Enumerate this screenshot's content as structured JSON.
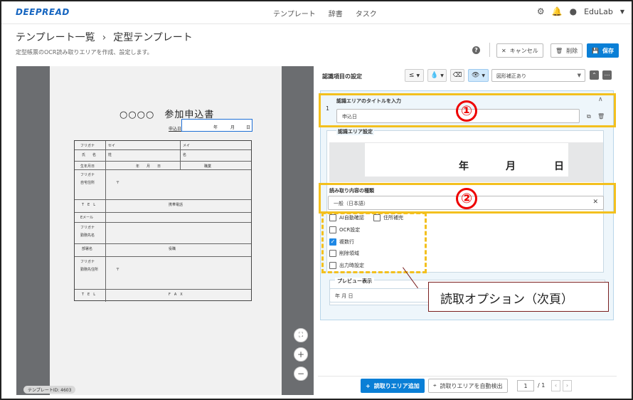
{
  "app": {
    "logo": "DEEPREAD",
    "nav": [
      "テンプレート",
      "辞書",
      "タスク"
    ],
    "user": "EduLab"
  },
  "header": {
    "breadcrumb_root": "テンプレート一覧",
    "breadcrumb_sep": "›",
    "breadcrumb_current": "定型テンプレート",
    "subtitle": "定型帳票のOCR読み取りエリアを作成、設定します。",
    "help": "?",
    "cancel": "キャンセル",
    "delete": "削除",
    "save": "保存"
  },
  "document": {
    "title": "○○○○　参加申込書",
    "date_label": "申込日",
    "date_fields": [
      "年",
      "月",
      "日"
    ],
    "rows": [
      {
        "a": "フリガナ",
        "b": "セイ",
        "c": "メイ"
      },
      {
        "a": "氏　　名",
        "b": "姓",
        "c": "名"
      },
      {
        "a": "生年月日",
        "b": "年　　月　　日",
        "c": "職業"
      },
      {
        "a": "フリガナ",
        "b": "",
        "c": ""
      },
      {
        "a": "自宅住所",
        "b": "〒",
        "c": ""
      },
      {
        "a": "T　E　L",
        "b": "",
        "c": "携帯電話"
      },
      {
        "a": "Eメール",
        "b": "",
        "c": ""
      },
      {
        "a": "フリガナ",
        "b": "",
        "c": ""
      },
      {
        "a": "勤務先名",
        "b": "",
        "c": ""
      },
      {
        "a": "部署名",
        "b": "",
        "c": "役職"
      },
      {
        "a": "フリガナ",
        "b": "",
        "c": ""
      },
      {
        "a": "勤務先住所",
        "b": "〒",
        "c": ""
      },
      {
        "a": "T　E　L",
        "b": "",
        "c": "F　A　X"
      }
    ],
    "template_id": "テンプレートID: 4603"
  },
  "settings": {
    "title": "認識項目の設定",
    "mode_select": "図形補正あり",
    "item_no": "1",
    "area_title_label": "認識エリアのタイトルを入力",
    "area_title_value": "申込日",
    "area_setting_label": "認識エリア設定",
    "area_preview_fields": [
      "年",
      "月",
      "日"
    ],
    "read_type_label": "読み取り内容の種類",
    "read_type_value": "一般（日本語）",
    "options": [
      {
        "label": "AI自動確認",
        "checked": false
      },
      {
        "label": "住所補完",
        "checked": false
      },
      {
        "label": "OCR設定",
        "checked": false
      },
      {
        "label": "複数行",
        "checked": true
      },
      {
        "label": "削除領域",
        "checked": false
      },
      {
        "label": "出力時設定",
        "checked": false
      }
    ],
    "preview_label": "プレビュー表示",
    "preview_value": "年 月 日"
  },
  "footer": {
    "add_area": "読取りエリア追加",
    "auto_detect": "読取りエリアを自動検出",
    "page_current": "1",
    "page_total": "/ 1"
  },
  "annotations": {
    "num1": "①",
    "num2": "②",
    "callout": "読取オプション（次頁）"
  },
  "colors": {
    "accent": "#0a7fd6",
    "highlight": "#f3c01e",
    "marker": "#ee0000"
  }
}
